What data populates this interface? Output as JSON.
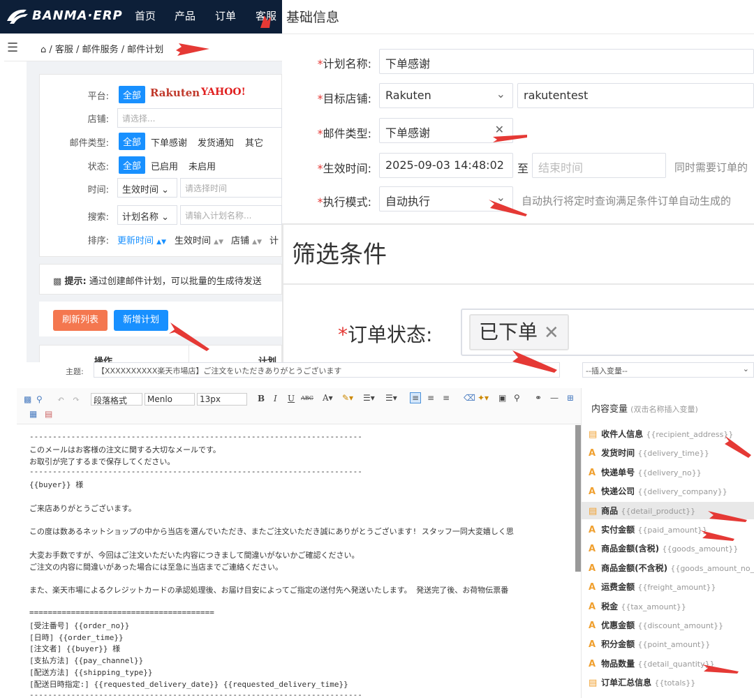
{
  "panelA": {
    "logo": "BANMA·ERP",
    "nav": [
      "首页",
      "产品",
      "订单",
      "客服"
    ],
    "breadcrumb": "/ 客服 / 邮件服务 / 邮件计划",
    "filters": {
      "platform_label": "平台:",
      "platform_all": "全部",
      "platform_rakuten": "Rakuten",
      "platform_yahoo": "YAHOO!",
      "shop_label": "店铺:",
      "shop_placeholder": "请选择...",
      "mailtype_label": "邮件类型:",
      "mailtype_options": [
        "全部",
        "下单感谢",
        "发货通知",
        "其它"
      ],
      "status_label": "状态:",
      "status_options": [
        "全部",
        "已启用",
        "未启用"
      ],
      "time_label": "时间:",
      "time_select": "生效时间",
      "time_placeholder": "请选择时间",
      "search_label": "搜索:",
      "search_select": "计划名称",
      "search_placeholder": "请输入计划名称...",
      "sort_label": "排序:",
      "sort_options": [
        "更新时间",
        "生效时间",
        "店铺",
        "计"
      ]
    },
    "tip_label": "提示:",
    "tip_text": "通过创建邮件计划，可以批量的生成待发送",
    "btn_refresh": "刷新列表",
    "btn_add": "新增计划",
    "table_headers": [
      "操作",
      "计划名"
    ]
  },
  "panelB": {
    "title": "基础信息",
    "plan_name_label": "计划名称:",
    "plan_name_value": "下单感谢",
    "shop_label": "目标店铺:",
    "shop_platform": "Rakuten",
    "shop_name": "rakutentest",
    "mailtype_label": "邮件类型:",
    "mailtype_value": "下单感谢",
    "time_label": "生效时间:",
    "time_start": "2025-09-03 14:48:02",
    "time_sep": "至",
    "time_end_placeholder": "结束时间",
    "time_hint": "同时需要订单的",
    "mode_label": "执行模式:",
    "mode_value": "自动执行",
    "mode_hint": "自动执行将定时查询满足条件订单自动生成的"
  },
  "panelC": {
    "title": "筛选条件",
    "status_label": "订单状态:",
    "status_tag": "已下单"
  },
  "panelD": {
    "subject_label": "主题:",
    "subject_value": "【XXXXXXXXXX楽天市場店】ご注文をいただきありがとうございます",
    "insert_var": "--插入变量--",
    "toolbar": {
      "format": "段落格式",
      "font": "Menlo",
      "size": "13px"
    },
    "editor_lines": [
      "------------------------------------------------------------------------",
      "このメールはお客様の注文に関する大切なメールです。",
      "お取引が完了するまで保存してください。",
      "------------------------------------------------------------------------",
      "{{buyer}} 様",
      "",
      "ご来店ありがとうございます。",
      "",
      "この度は数あるネットショップの中から当店を選んでいただき、またご注文いただき誠にありがとうございます! スタッフ一同大変嬉しく思",
      "",
      "大変お手数ですが、今回はご注文いただいた内容につきまして間違いがないかご確認ください。",
      "ご注文の内容に間違いがあった場合には至急に当店までご連絡ください。",
      "",
      "また、楽天市場によるクレジットカードの承認処理後、お届け目安によってご指定の送付先へ発送いたします。 発送完了後、お荷物伝票番",
      "",
      "========================================",
      "[受注番号] {{order_no}}",
      "[日時] {{order_time}}",
      "[注文者] {{buyer}} 様",
      "[支払方法] {{pay_channel}}",
      "[配送方法] {{shipping_type}}",
      "[配送日時指定:] {{requested_delivery_date}} {{requested_delivery_time}}",
      "------------------------------------------------------------------------"
    ],
    "var_title": "内容变量",
    "var_hint": "(双击名称插入变量)",
    "vars": [
      {
        "icon": "table",
        "name": "收件人信息",
        "code": "{{recipient_address}}"
      },
      {
        "icon": "A",
        "name": "发货时间",
        "code": "{{delivery_time}}"
      },
      {
        "icon": "A",
        "name": "快递单号",
        "code": "{{delivery_no}}"
      },
      {
        "icon": "A",
        "name": "快递公司",
        "code": "{{delivery_company}}"
      },
      {
        "icon": "table",
        "name": "商品",
        "code": "{{detail_product}}"
      },
      {
        "icon": "A",
        "name": "实付金额",
        "code": "{{paid_amount}}"
      },
      {
        "icon": "A",
        "name": "商品金额(含税)",
        "code": "{{goods_amount}}"
      },
      {
        "icon": "A",
        "name": "商品金额(不含税)",
        "code": "{{goods_amount_no_t..."
      },
      {
        "icon": "A",
        "name": "运费金额",
        "code": "{{freight_amount}}"
      },
      {
        "icon": "A",
        "name": "税金",
        "code": "{{tax_amount}}"
      },
      {
        "icon": "A",
        "name": "优惠金额",
        "code": "{{discount_amount}}"
      },
      {
        "icon": "A",
        "name": "积分金额",
        "code": "{{point_amount}}"
      },
      {
        "icon": "A",
        "name": "物品数量",
        "code": "{{detail_quantity}}"
      },
      {
        "icon": "table",
        "name": "订单汇总信息",
        "code": "{{totals}}"
      }
    ]
  },
  "colors": {
    "primary": "#1890ff",
    "navbg": "#0d1f38",
    "orange": "#f4774f",
    "red_arrow": "#e53935",
    "required": "#e53935"
  }
}
